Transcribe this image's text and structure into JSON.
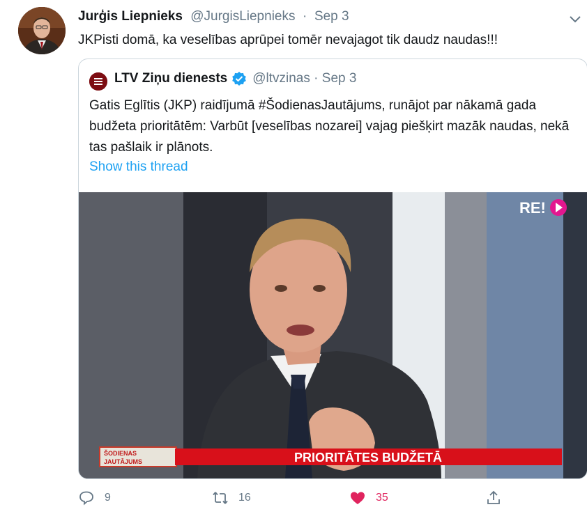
{
  "tweet": {
    "author_name": "Jurģis Liepnieks",
    "author_handle": "@JurgisLiepnieks",
    "separator": "·",
    "date": "Sep 3",
    "text": "JKPisti domā, ka veselības aprūpei tomēr nevajagot tik daudz naudas!!!"
  },
  "quoted": {
    "author_name": "LTV Ziņu dienests",
    "author_handle": "@ltvzinas",
    "separator": "·",
    "date": "Sep 3",
    "verified": true,
    "text": "Gatis Eglītis (JKP) raidījumā #ŠodienasJautājums, runājot par nākamā gada budžeta prioritātēm: Varbūt [veselības nozarei] vajag piešķirt mazāk naudas, nekā tas pašlaik ir plānots.",
    "show_thread": "Show this thread",
    "media": {
      "channel_logo": "RE!",
      "show_label_line1": "ŠODIENAS",
      "show_label_line2": "JAUTĀJUMS",
      "banner": "PRIORITĀTES BUDŽETĀ"
    }
  },
  "actions": {
    "reply_count": "9",
    "retweet_count": "16",
    "like_count": "35"
  },
  "colors": {
    "link": "#1da1f2",
    "muted": "#657786",
    "like": "#e0245e",
    "banner": "#d8101a"
  }
}
